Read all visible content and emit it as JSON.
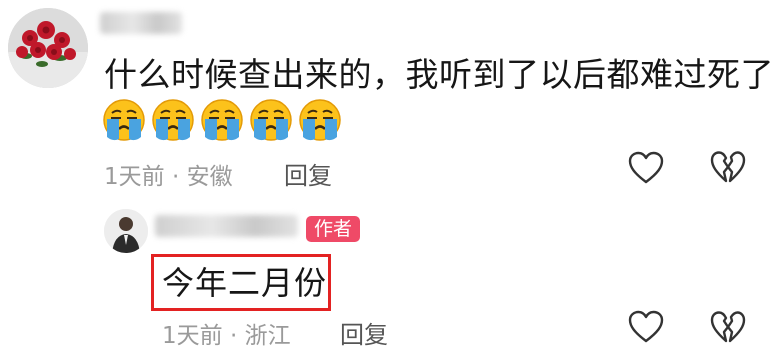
{
  "comment": {
    "avatar": "rose-bouquet-avatar",
    "text": "什么时候查出来的，我听到了以后都难过死了",
    "emojis": [
      "crying-face",
      "crying-face",
      "crying-face",
      "crying-face",
      "crying-face"
    ],
    "time": "1天前",
    "separator": "·",
    "location": "安徽",
    "reply_label": "回复"
  },
  "reply": {
    "avatar": "person-avatar",
    "badge": "作者",
    "text": "今年二月份",
    "time": "1天前",
    "separator": "·",
    "location": "浙江",
    "reply_label": "回复"
  },
  "colors": {
    "badge_bg": "#ef4a67",
    "highlight_border": "#e32222",
    "meta_text": "#9a9a9a"
  },
  "icons": {
    "like": "heart-outline-icon",
    "dislike": "broken-heart-outline-icon"
  }
}
